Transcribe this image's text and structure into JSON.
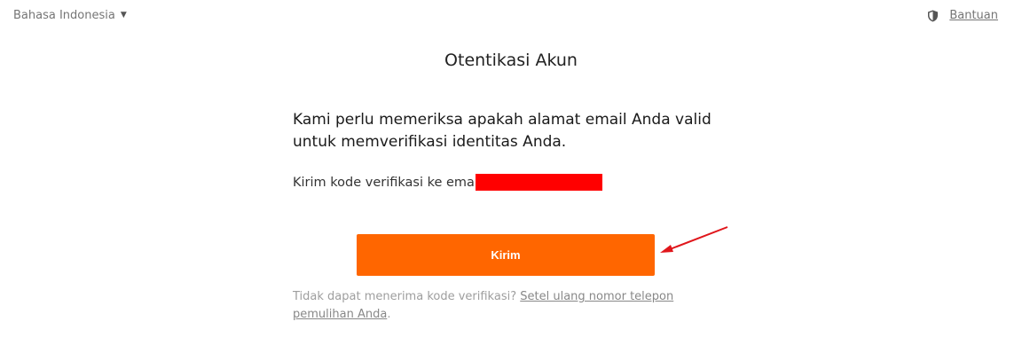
{
  "header": {
    "language_label": "Bahasa Indonesia",
    "help_label": "Bantuan"
  },
  "main": {
    "title": "Otentikasi Akun",
    "lead_text": "Kami perlu memeriksa apakah alamat email Anda valid untuk memverifikasi identitas Anda.",
    "send_to_text": "Kirim kode verifikasi ke emai",
    "submit_label": "Kirim",
    "footer_text": "Tidak dapat menerima kode verifikasi?",
    "footer_link": "Setel ulang nomor telepon pemulihan Anda",
    "footer_end": "."
  },
  "colors": {
    "accent": "#ff6600",
    "redaction": "#ff0000",
    "annotation_arrow": "#e0161b"
  },
  "icons": {
    "language_caret": "caret-down-icon",
    "help": "shield-icon",
    "annotation": "arrow-icon"
  }
}
